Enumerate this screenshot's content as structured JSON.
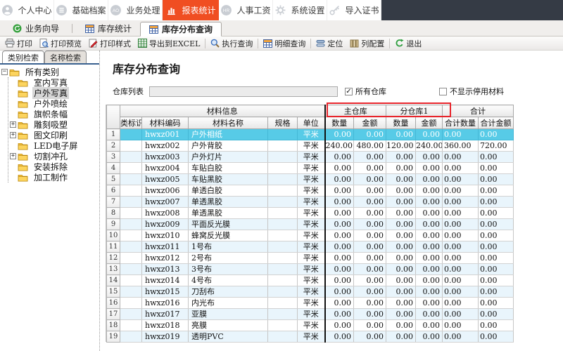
{
  "colors": {
    "accent_red": "#f04e22",
    "annotation_red": "#e8242b",
    "selected_row": "#57cbe7",
    "menu_dark": "#353b45"
  },
  "menu_bar": {
    "items": [
      {
        "id": "personal-center",
        "label": "个人中心",
        "icon": "user",
        "active": false
      },
      {
        "id": "base-archives",
        "label": "基础档案",
        "icon": "list",
        "active": false
      },
      {
        "id": "business-process",
        "label": "业务处理",
        "icon": "ao",
        "active": false
      },
      {
        "id": "report-statistics",
        "label": "报表统计",
        "icon": "chart",
        "active": true
      },
      {
        "id": "hr-payroll",
        "label": "人事工资",
        "icon": "hr",
        "active": false
      },
      {
        "id": "system-settings",
        "label": "系统设置",
        "icon": "gear",
        "active": false
      },
      {
        "id": "import-certificate",
        "label": "导入证书",
        "icon": "key",
        "active": false
      }
    ]
  },
  "tab_bar": {
    "tabs": [
      {
        "id": "business-wizard",
        "label": "业务向导",
        "icon": "wizard",
        "active": false
      },
      {
        "id": "inventory-statistics",
        "label": "库存统计",
        "icon": "table",
        "active": false
      },
      {
        "id": "inventory-distribution-query",
        "label": "库存分布查询",
        "icon": "table",
        "active": true
      }
    ]
  },
  "toolbar": {
    "buttons": [
      {
        "id": "print",
        "label": "打印",
        "icon": "print",
        "sep_before": false
      },
      {
        "id": "print-preview",
        "label": "打印预览",
        "icon": "preview",
        "sep_before": false
      },
      {
        "id": "print-style",
        "label": "打印样式",
        "icon": "style",
        "sep_before": false
      },
      {
        "id": "export-excel",
        "label": "导出到EXCEL",
        "icon": "excel",
        "sep_before": false
      },
      {
        "id": "execute-query",
        "label": "执行查询",
        "icon": "query",
        "sep_before": true
      },
      {
        "id": "detail-query",
        "label": "明细查询",
        "icon": "table",
        "sep_before": true
      },
      {
        "id": "locate",
        "label": "定位",
        "icon": "locate",
        "sep_before": true
      },
      {
        "id": "column-config",
        "label": "列配置",
        "icon": "columns",
        "sep_before": false
      },
      {
        "id": "exit",
        "label": "退出",
        "icon": "exit",
        "sep_before": true
      }
    ]
  },
  "sidebar": {
    "tabs": [
      {
        "id": "category-search",
        "label": "类别检索",
        "active": true
      },
      {
        "id": "name-search",
        "label": "名称检索",
        "active": false
      }
    ],
    "tree": {
      "root": {
        "label": "所有类别",
        "expanded": true
      },
      "items": [
        {
          "id": "indoor-photo",
          "label": "室内写真",
          "expandable": false,
          "selected": false
        },
        {
          "id": "outdoor-photo",
          "label": "户外写真",
          "expandable": false,
          "selected": true
        },
        {
          "id": "outdoor-spray",
          "label": "户外喷绘",
          "expandable": false,
          "selected": false
        },
        {
          "id": "flag-banner",
          "label": "旗帜条幅",
          "expandable": false,
          "selected": false
        },
        {
          "id": "carving-blister",
          "label": "雕刻吸塑",
          "expandable": true,
          "selected": false
        },
        {
          "id": "graphic-printing",
          "label": "图文印刷",
          "expandable": true,
          "selected": false
        },
        {
          "id": "led-screen",
          "label": "LED电子屏",
          "expandable": false,
          "selected": false
        },
        {
          "id": "cutting-punching",
          "label": "切割冲孔",
          "expandable": true,
          "selected": false
        },
        {
          "id": "installation-removal",
          "label": "安装拆除",
          "expandable": false,
          "selected": false
        },
        {
          "id": "processing",
          "label": "加工制作",
          "expandable": false,
          "selected": false
        }
      ]
    }
  },
  "main": {
    "title": "库存分布查询",
    "filter": {
      "warehouse_label": "仓库列表",
      "warehouse_value": "",
      "all_warehouses": {
        "label": "所有仓库",
        "checked": true
      },
      "hide_disabled": {
        "label": "不显示停用材料",
        "checked": false
      }
    },
    "table": {
      "group_headers": [
        {
          "label": "材料信息",
          "span": 5
        },
        {
          "label": "主仓库",
          "span": 2
        },
        {
          "label": "分仓库1",
          "span": 2
        },
        {
          "label": "合计",
          "span": 2
        }
      ],
      "columns": [
        "类标识",
        "材料编码",
        "材料名称",
        "规格",
        "单位",
        "数量",
        "金额",
        "数量",
        "金额",
        "合计数量",
        "合计金额"
      ],
      "rows": [
        {
          "num": 1,
          "flag": "",
          "code": "hwxz001",
          "name": "户外相纸",
          "spec": "",
          "unit": "平米",
          "qty1": "0.00",
          "amt1": "0.00",
          "qty2": "0.00",
          "amt2": "0.00",
          "total_qty": "0.00",
          "total_amt": "0.00",
          "selected": true
        },
        {
          "num": 2,
          "flag": "",
          "code": "hwxz002",
          "name": "户外背胶",
          "spec": "",
          "unit": "平米",
          "qty1": "240.00",
          "amt1": "480.00",
          "qty2": "120.00",
          "amt2": "240.00",
          "total_qty": "360.00",
          "total_amt": "720.00",
          "selected": false
        },
        {
          "num": 3,
          "flag": "",
          "code": "hwxz003",
          "name": "户外灯片",
          "spec": "",
          "unit": "平米",
          "qty1": "0.00",
          "amt1": "0.00",
          "qty2": "0.00",
          "amt2": "0.00",
          "total_qty": "0.00",
          "total_amt": "0.00",
          "selected": false
        },
        {
          "num": 4,
          "flag": "",
          "code": "hwxz004",
          "name": "车贴白胶",
          "spec": "",
          "unit": "平米",
          "qty1": "0.00",
          "amt1": "0.00",
          "qty2": "0.00",
          "amt2": "0.00",
          "total_qty": "0.00",
          "total_amt": "0.00",
          "selected": false
        },
        {
          "num": 5,
          "flag": "",
          "code": "hwxz005",
          "name": "车贴黑胶",
          "spec": "",
          "unit": "平米",
          "qty1": "0.00",
          "amt1": "0.00",
          "qty2": "0.00",
          "amt2": "0.00",
          "total_qty": "0.00",
          "total_amt": "0.00",
          "selected": false
        },
        {
          "num": 6,
          "flag": "",
          "code": "hwxz006",
          "name": "单透白胶",
          "spec": "",
          "unit": "平米",
          "qty1": "0.00",
          "amt1": "0.00",
          "qty2": "0.00",
          "amt2": "0.00",
          "total_qty": "0.00",
          "total_amt": "0.00",
          "selected": false
        },
        {
          "num": 7,
          "flag": "",
          "code": "hwxz007",
          "name": "单透黑胶",
          "spec": "",
          "unit": "平米",
          "qty1": "0.00",
          "amt1": "0.00",
          "qty2": "0.00",
          "amt2": "0.00",
          "total_qty": "0.00",
          "total_amt": "0.00",
          "selected": false
        },
        {
          "num": 8,
          "flag": "",
          "code": "hwxz008",
          "name": "单透黑胶",
          "spec": "",
          "unit": "平米",
          "qty1": "0.00",
          "amt1": "0.00",
          "qty2": "0.00",
          "amt2": "0.00",
          "total_qty": "0.00",
          "total_amt": "0.00",
          "selected": false
        },
        {
          "num": 9,
          "flag": "",
          "code": "hwxz009",
          "name": "平面反光膜",
          "spec": "",
          "unit": "平米",
          "qty1": "0.00",
          "amt1": "0.00",
          "qty2": "0.00",
          "amt2": "0.00",
          "total_qty": "0.00",
          "total_amt": "0.00",
          "selected": false
        },
        {
          "num": 10,
          "flag": "",
          "code": "hwxz010",
          "name": "蜂窝反光膜",
          "spec": "",
          "unit": "平米",
          "qty1": "0.00",
          "amt1": "0.00",
          "qty2": "0.00",
          "amt2": "0.00",
          "total_qty": "0.00",
          "total_amt": "0.00",
          "selected": false
        },
        {
          "num": 11,
          "flag": "",
          "code": "hwxz011",
          "name": "1号布",
          "spec": "",
          "unit": "平米",
          "qty1": "0.00",
          "amt1": "0.00",
          "qty2": "0.00",
          "amt2": "0.00",
          "total_qty": "0.00",
          "total_amt": "0.00",
          "selected": false
        },
        {
          "num": 12,
          "flag": "",
          "code": "hwxz012",
          "name": "2号布",
          "spec": "",
          "unit": "平米",
          "qty1": "0.00",
          "amt1": "0.00",
          "qty2": "0.00",
          "amt2": "0.00",
          "total_qty": "0.00",
          "total_amt": "0.00",
          "selected": false
        },
        {
          "num": 13,
          "flag": "",
          "code": "hwxz013",
          "name": "3号布",
          "spec": "",
          "unit": "平米",
          "qty1": "0.00",
          "amt1": "0.00",
          "qty2": "0.00",
          "amt2": "0.00",
          "total_qty": "0.00",
          "total_amt": "0.00",
          "selected": false
        },
        {
          "num": 14,
          "flag": "",
          "code": "hwxz014",
          "name": "4号布",
          "spec": "",
          "unit": "平米",
          "qty1": "0.00",
          "amt1": "0.00",
          "qty2": "0.00",
          "amt2": "0.00",
          "total_qty": "0.00",
          "total_amt": "0.00",
          "selected": false
        },
        {
          "num": 15,
          "flag": "",
          "code": "hwxz015",
          "name": "刀刮布",
          "spec": "",
          "unit": "平米",
          "qty1": "0.00",
          "amt1": "0.00",
          "qty2": "0.00",
          "amt2": "0.00",
          "total_qty": "0.00",
          "total_amt": "0.00",
          "selected": false
        },
        {
          "num": 16,
          "flag": "",
          "code": "hwxz016",
          "name": "内光布",
          "spec": "",
          "unit": "平米",
          "qty1": "0.00",
          "amt1": "0.00",
          "qty2": "0.00",
          "amt2": "0.00",
          "total_qty": "0.00",
          "total_amt": "0.00",
          "selected": false
        },
        {
          "num": 17,
          "flag": "",
          "code": "hwxz017",
          "name": "亚膜",
          "spec": "",
          "unit": "平米",
          "qty1": "0.00",
          "amt1": "0.00",
          "qty2": "0.00",
          "amt2": "0.00",
          "total_qty": "0.00",
          "total_amt": "0.00",
          "selected": false
        },
        {
          "num": 18,
          "flag": "",
          "code": "hwxz018",
          "name": "亮膜",
          "spec": "",
          "unit": "平米",
          "qty1": "0.00",
          "amt1": "0.00",
          "qty2": "0.00",
          "amt2": "0.00",
          "total_qty": "0.00",
          "total_amt": "0.00",
          "selected": false
        },
        {
          "num": 19,
          "flag": "",
          "code": "hwxz019",
          "name": "透明PVC",
          "spec": "",
          "unit": "平米",
          "qty1": "0.00",
          "amt1": "0.00",
          "qty2": "0.00",
          "amt2": "0.00",
          "total_qty": "0.00",
          "total_amt": "0.00",
          "selected": false
        }
      ]
    }
  }
}
